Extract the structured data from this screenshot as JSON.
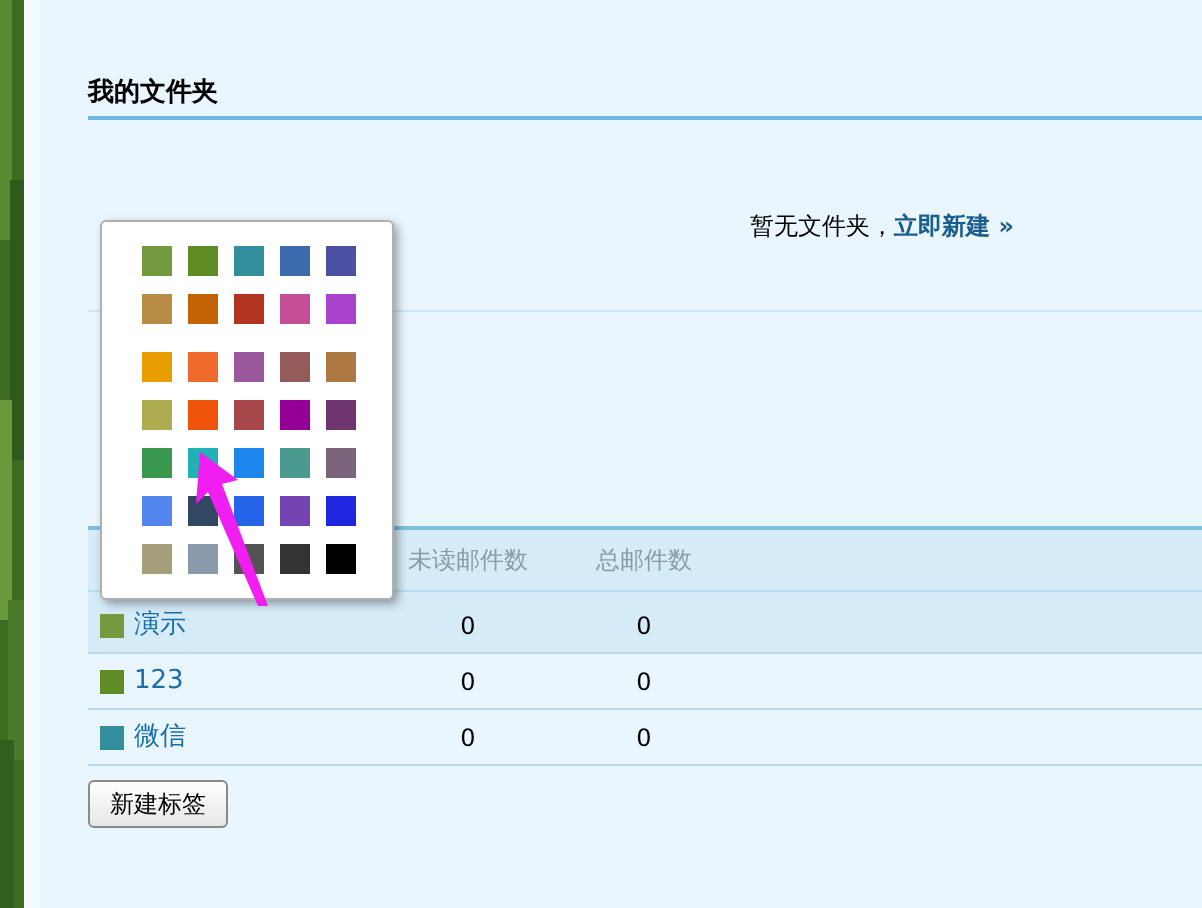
{
  "folders": {
    "title": "我的文件夹",
    "empty_text": "暂无文件夹，",
    "create_link": "立即新建 »"
  },
  "tags_table": {
    "columns": [
      "未读邮件数",
      "总邮件数"
    ],
    "rows": [
      {
        "name": "演示",
        "color": "#739a3e",
        "unread": "0",
        "total": "0",
        "highlighted": true
      },
      {
        "name": "123",
        "color": "#5f8c24",
        "unread": "0",
        "total": "0",
        "highlighted": false
      },
      {
        "name": "微信",
        "color": "#348f9c",
        "unread": "0",
        "total": "0",
        "highlighted": false
      }
    ]
  },
  "new_tag_button": "新建标签",
  "color_picker": {
    "groups": [
      [
        {
          "color": "#739a3e"
        },
        {
          "color": "#5f8c24"
        },
        {
          "color": "#348f9c"
        },
        {
          "color": "#3b6aad"
        },
        {
          "color": "#4b50a3"
        },
        {
          "color": "#b88c44"
        },
        {
          "color": "#c46406"
        },
        {
          "color": "#b3341e"
        },
        {
          "color": "#c54f96"
        },
        {
          "color": "#a942cc"
        }
      ],
      [
        {
          "color": "#e89e00"
        },
        {
          "color": "#ef6a2c"
        },
        {
          "color": "#9c589c"
        },
        {
          "color": "#955a5a"
        },
        {
          "color": "#ae7843"
        },
        {
          "color": "#aeac50"
        },
        {
          "color": "#ef5209"
        },
        {
          "color": "#a8474a"
        },
        {
          "color": "#940096"
        },
        {
          "color": "#6e3570"
        },
        {
          "color": "#3a974f"
        },
        {
          "color": "#22b1b4"
        },
        {
          "color": "#1e87ee"
        },
        {
          "color": "#4b9a8f"
        },
        {
          "color": "#7b637c"
        },
        {
          "color": "#5386ed"
        },
        {
          "color": "#324862"
        },
        {
          "color": "#2563e8"
        },
        {
          "color": "#7445b2"
        },
        {
          "color": "#2026e0"
        },
        {
          "color": "#a49e7b"
        },
        {
          "color": "#8a9aab"
        },
        {
          "color": "#545454"
        },
        {
          "color": "#333333"
        },
        {
          "color": "#000000"
        }
      ]
    ]
  }
}
